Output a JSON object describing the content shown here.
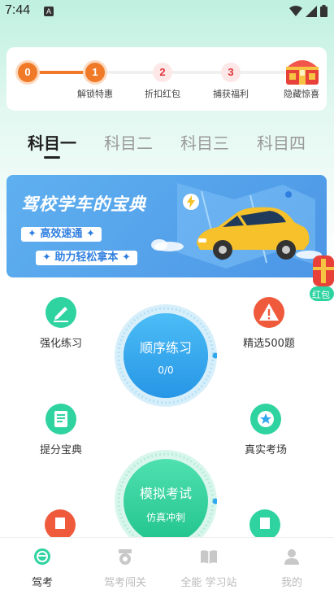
{
  "status_bar": {
    "time": "7:44",
    "notif_letter": "A"
  },
  "progress": {
    "steps": [
      {
        "number": "0",
        "label": ""
      },
      {
        "number": "1",
        "label": "解锁特惠"
      },
      {
        "number": "2",
        "label": "折扣红包"
      },
      {
        "number": "3",
        "label": "捕获福利"
      }
    ],
    "final_label": "隐藏惊喜",
    "completed_steps": 2,
    "colors": {
      "done": "#f07a28",
      "todo": "#fde7e7"
    }
  },
  "tabs": [
    {
      "label": "科目一",
      "active": true
    },
    {
      "label": "科目二",
      "active": false
    },
    {
      "label": "科目三",
      "active": false
    },
    {
      "label": "科目四",
      "active": false
    }
  ],
  "banner": {
    "title": "驾校学车的宝典",
    "pill1": "✦ 高效速通 ✦",
    "pill2": "✦ 助力轻松拿本 ✦"
  },
  "features": {
    "strengthen": "强化练习",
    "selected500": "精选500题",
    "improve": "提分宝典",
    "real_exam": "真实考场"
  },
  "sequential": {
    "title": "顺序练习",
    "progress": "0/0"
  },
  "mock_exam": {
    "title": "模拟考试",
    "subtitle": "仿真冲刺"
  },
  "redpack": {
    "label": "红包"
  },
  "bottom_nav": [
    {
      "label": "驾考",
      "active": true
    },
    {
      "label": "驾考闯关",
      "active": false
    },
    {
      "label": "全能 学习站",
      "active": false
    },
    {
      "label": "我的",
      "active": false
    }
  ],
  "accent_colors": {
    "green": "#2fd3a0",
    "blue": "#2fa8ee",
    "orange": "#f07a28",
    "red": "#f05a3c"
  }
}
